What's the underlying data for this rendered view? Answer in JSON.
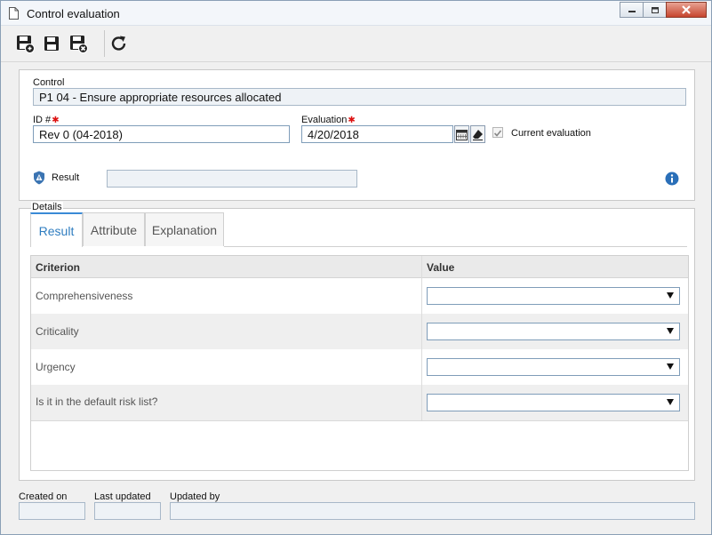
{
  "window": {
    "title": "Control evaluation"
  },
  "toolbar": {
    "items": [
      {
        "icon": "save-new-icon"
      },
      {
        "icon": "save-icon"
      },
      {
        "icon": "save-close-icon"
      },
      {
        "icon": "refresh-icon"
      }
    ]
  },
  "form": {
    "control_label": "Control",
    "control_value": "P1 04 - Ensure appropriate resources allocated",
    "id_label": "ID #",
    "id_value": "Rev 0 (04-2018)",
    "evaluation_label": "Evaluation",
    "evaluation_value": "4/20/2018",
    "current_evaluation_label": "Current evaluation",
    "current_evaluation_checked": true,
    "result_label": "Result",
    "result_value": ""
  },
  "details": {
    "legend": "Details",
    "tabs": [
      {
        "label": "Result",
        "active": true
      },
      {
        "label": "Attribute",
        "active": false
      },
      {
        "label": "Explanation",
        "active": false
      }
    ],
    "grid": {
      "columns": [
        "Criterion",
        "Value"
      ],
      "rows": [
        {
          "criterion": "Comprehensiveness",
          "value": ""
        },
        {
          "criterion": "Criticality",
          "value": ""
        },
        {
          "criterion": "Urgency",
          "value": ""
        },
        {
          "criterion": "Is it in the default risk list?",
          "value": ""
        }
      ]
    }
  },
  "footer": {
    "created_on_label": "Created on",
    "created_on_value": "",
    "last_updated_label": "Last updated",
    "last_updated_value": "",
    "updated_by_label": "Updated by",
    "updated_by_value": ""
  },
  "colors": {
    "accent": "#2f7dc0",
    "required": "#dd1111",
    "info": "#2a6fb8"
  }
}
